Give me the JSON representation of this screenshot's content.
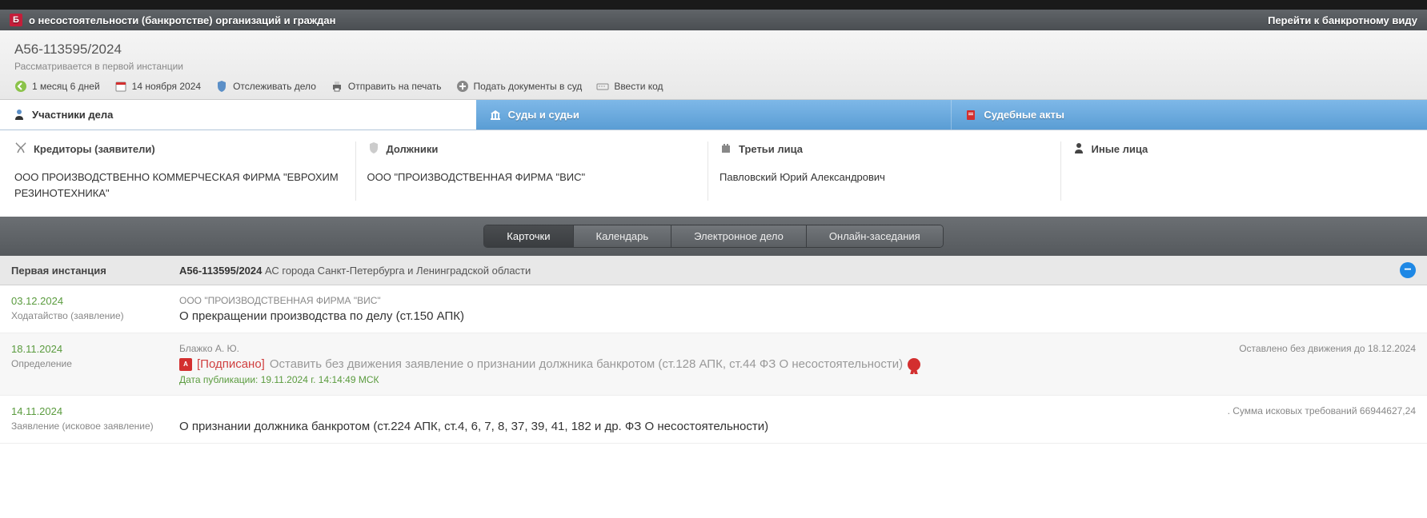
{
  "header": {
    "badge": "Б",
    "title": "о несостоятельности (банкротстве) организаций и граждан",
    "goto": "Перейти к банкротному виду"
  },
  "case": {
    "number": "А56-113595/2024",
    "status": "Рассматривается в первой инстанции",
    "toolbar": {
      "duration": "1 месяц 6 дней",
      "date": "14 ноября 2024",
      "track": "Отслеживать дело",
      "print": "Отправить на печать",
      "submit": "Подать документы в суд",
      "code": "Ввести код"
    }
  },
  "tabs": {
    "participants": "Участники дела",
    "courts": "Суды и судьи",
    "acts": "Судебные акты"
  },
  "parties": {
    "creditors": {
      "label": "Кредиторы (заявители)",
      "value": "ООО ПРОИЗВОДСТВЕННО КОММЕРЧЕСКАЯ ФИРМА \"ЕВРОХИМ РЕЗИНОТЕХНИКА\""
    },
    "debtors": {
      "label": "Должники",
      "value": "ООО \"ПРОИЗВОДСТВЕННАЯ ФИРМА \"ВИС\""
    },
    "third": {
      "label": "Третьи лица",
      "value": "Павловский Юрий Александрович"
    },
    "other": {
      "label": "Иные лица",
      "value": ""
    }
  },
  "subtabs": {
    "cards": "Карточки",
    "calendar": "Календарь",
    "edoc": "Электронное дело",
    "online": "Онлайн-заседания"
  },
  "instance": {
    "label": "Первая инстанция",
    "caseno": "А56-113595/2024",
    "court": " АС города Санкт-Петербурга и Ленинградской области"
  },
  "entries": [
    {
      "date": "03.12.2024",
      "type": "Ходатайство (заявление)",
      "author": "ООО \"ПРОИЗВОДСТВЕННАЯ ФИРМА \"ВИС\"",
      "title": "О прекращении производства по делу (ст.150 АПК)"
    },
    {
      "date": "18.11.2024",
      "type": "Определение",
      "author": "Блажко А. Ю.",
      "signed": "[Подписано]",
      "title_gray": "Оставить без движения заявление о признании должника банкротом (ст.128 АПК, ст.44 ФЗ О несостоятельности)",
      "pubdate": "Дата публикации: 19.11.2024 г. 14:14:49 МСК",
      "right_note": "Оставлено без движения до 18.12.2024",
      "has_pdf": true,
      "has_seal": true
    },
    {
      "date": "14.11.2024",
      "type": "Заявление (исковое заявление)",
      "title": "О признании должника банкротом (ст.224 АПК, ст.4, 6, 7, 8, 37, 39, 41, 182 и др. ФЗ О несостоятельности)",
      "right_note": ". Сумма исковых требований 66944627,24"
    }
  ]
}
